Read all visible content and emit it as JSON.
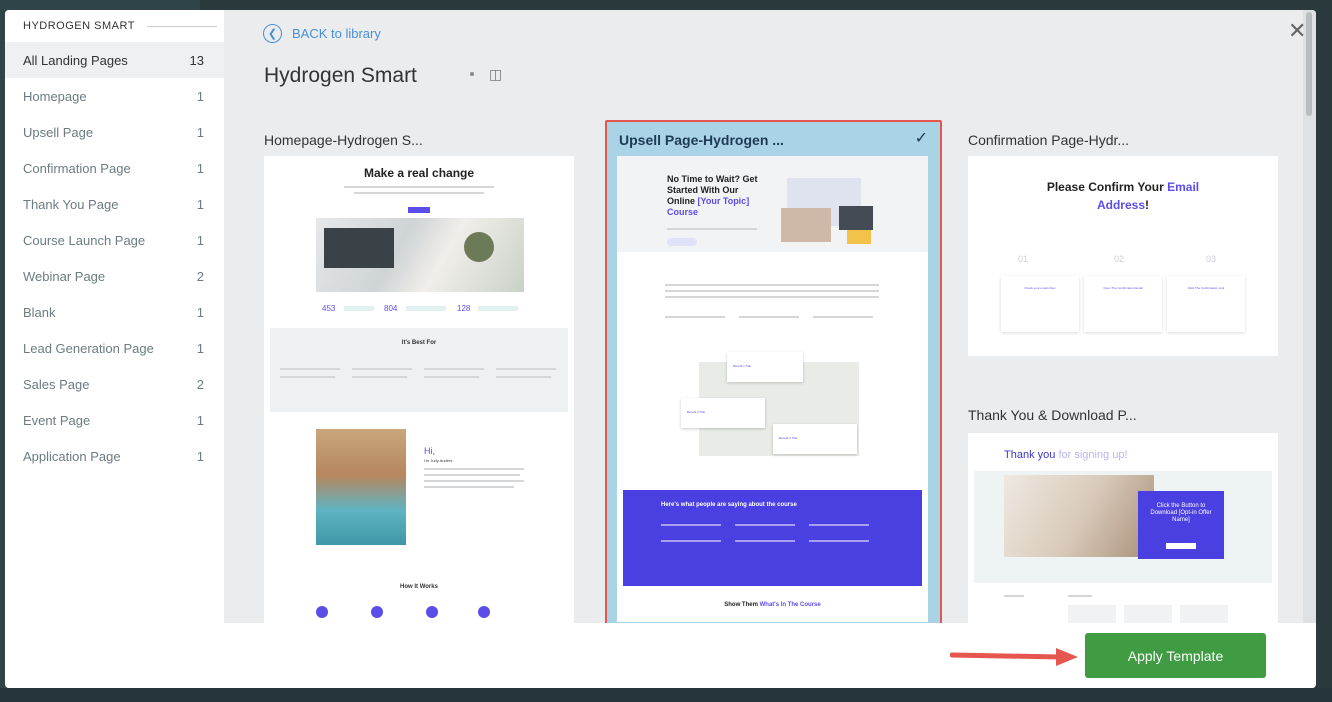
{
  "sidebar": {
    "header": "HYDROGEN SMART",
    "items": [
      {
        "label": "All Landing Pages",
        "count": "13"
      },
      {
        "label": "Homepage",
        "count": "1"
      },
      {
        "label": "Upsell Page",
        "count": "1"
      },
      {
        "label": "Confirmation Page",
        "count": "1"
      },
      {
        "label": "Thank You Page",
        "count": "1"
      },
      {
        "label": "Course Launch Page",
        "count": "1"
      },
      {
        "label": "Webinar Page",
        "count": "2"
      },
      {
        "label": "Blank",
        "count": "1"
      },
      {
        "label": "Lead Generation Page",
        "count": "1"
      },
      {
        "label": "Sales Page",
        "count": "2"
      },
      {
        "label": "Event Page",
        "count": "1"
      },
      {
        "label": "Application Page",
        "count": "1"
      }
    ]
  },
  "main": {
    "back_label": "BACK to library",
    "title": "Hydrogen Smart",
    "close_icon": "close-icon",
    "cards": {
      "homepage": {
        "title": "Homepage-Hydrogen S...",
        "headline": "Make a real change",
        "stats": [
          "453",
          "804",
          "128"
        ],
        "best_for": "It's Best For",
        "hi": "Hi,",
        "name": "I'm Judy Anders",
        "how": "How It Works"
      },
      "upsell": {
        "title": "Upsell Page-Hydrogen ...",
        "headline_1": "No Time to Wait? Get",
        "headline_2": "Started With Our",
        "headline_3": "Online",
        "headline_topic": "[Your Topic]",
        "headline_4": "Course",
        "benefit_1": "Benefit 1 Title",
        "benefit_2": "Benefit 2 Title",
        "benefit_3": "Benefit 3 Title",
        "testimonials": "Here's what people are saying about the course",
        "show_1": "Show Them",
        "show_2": "What's In The Course"
      },
      "confirmation": {
        "title": "Confirmation Page-Hydr...",
        "headline_1": "Please Confirm Your",
        "headline_email": "Email",
        "headline_address": "Address",
        "steps": [
          "01",
          "02",
          "03"
        ],
        "step_labels": [
          "Check your email inbox",
          "Open The Confirmation Email",
          "Click The Confirmation Link"
        ]
      },
      "thankyou": {
        "title": "Thank You & Download P...",
        "thank": "Thank you",
        "signing": "for signing up!",
        "cta": "Click the Button to Download [Opt-in Offer Name]"
      }
    }
  },
  "footer": {
    "apply_label": "Apply Template"
  },
  "colors": {
    "accent_blue": "#4a8fd6",
    "brand_purple": "#4a3fe0",
    "apply_green": "#3f9c42",
    "selection_red": "#e5574e"
  }
}
